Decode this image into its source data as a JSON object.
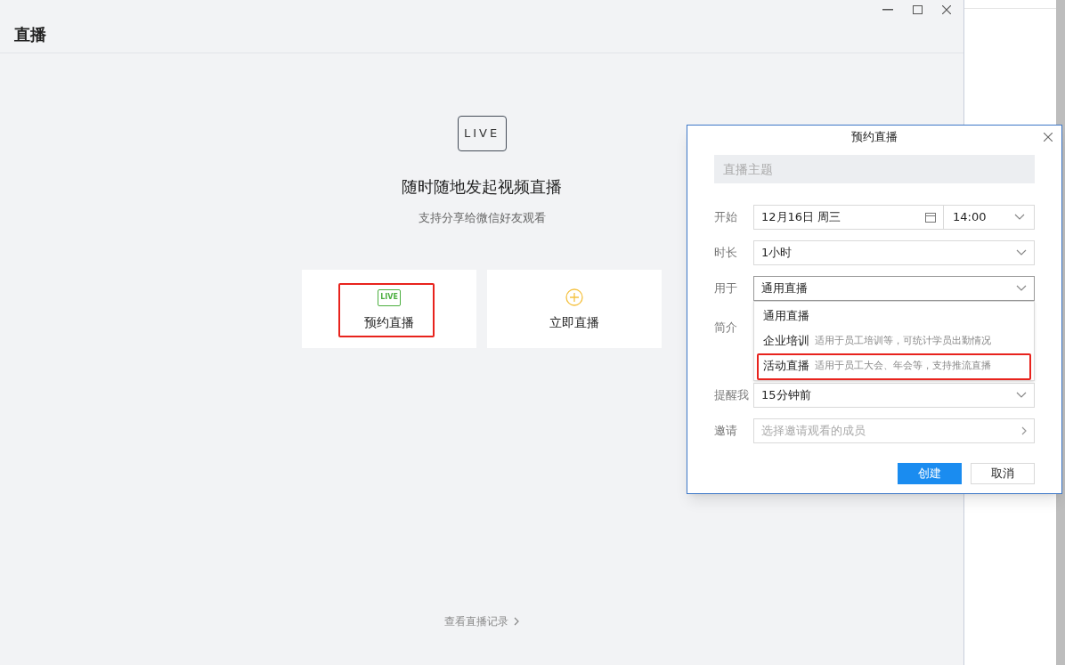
{
  "window": {
    "title": "直播"
  },
  "hero": {
    "badge": "LIVE",
    "headline": "随时随地发起视频直播",
    "subtitle": "支持分享给微信好友观看"
  },
  "actions": [
    {
      "kind": "schedule",
      "label": "预约直播",
      "icon_text": "LIVE",
      "highlighted": true
    },
    {
      "kind": "now",
      "label": "立即直播",
      "highlighted": false
    }
  ],
  "history_link": "查看直播记录",
  "dialog": {
    "title": "预约直播",
    "topic_placeholder": "直播主题",
    "start": {
      "label": "开始",
      "date": "12月16日 周三",
      "time": "14:00"
    },
    "duration": {
      "label": "时长",
      "value": "1小时"
    },
    "usage": {
      "label": "用于",
      "value": "通用直播",
      "expanded": true,
      "options": [
        {
          "label": "通用直播",
          "highlighted": false
        },
        {
          "label": "企业培训",
          "description": "适用于员工培训等，可统计学员出勤情况",
          "highlighted": false
        },
        {
          "label": "活动直播",
          "description": "适用于员工大会、年会等，支持推流直播",
          "highlighted": true
        }
      ]
    },
    "intro": {
      "label": "简介"
    },
    "remind": {
      "label": "提醒我",
      "value": "15分钟前"
    },
    "invite": {
      "label": "邀请",
      "placeholder": "选择邀请观看的成员"
    },
    "buttons": [
      {
        "kind": "primary",
        "label": "创建"
      },
      {
        "kind": "secondary",
        "label": "取消"
      }
    ]
  }
}
